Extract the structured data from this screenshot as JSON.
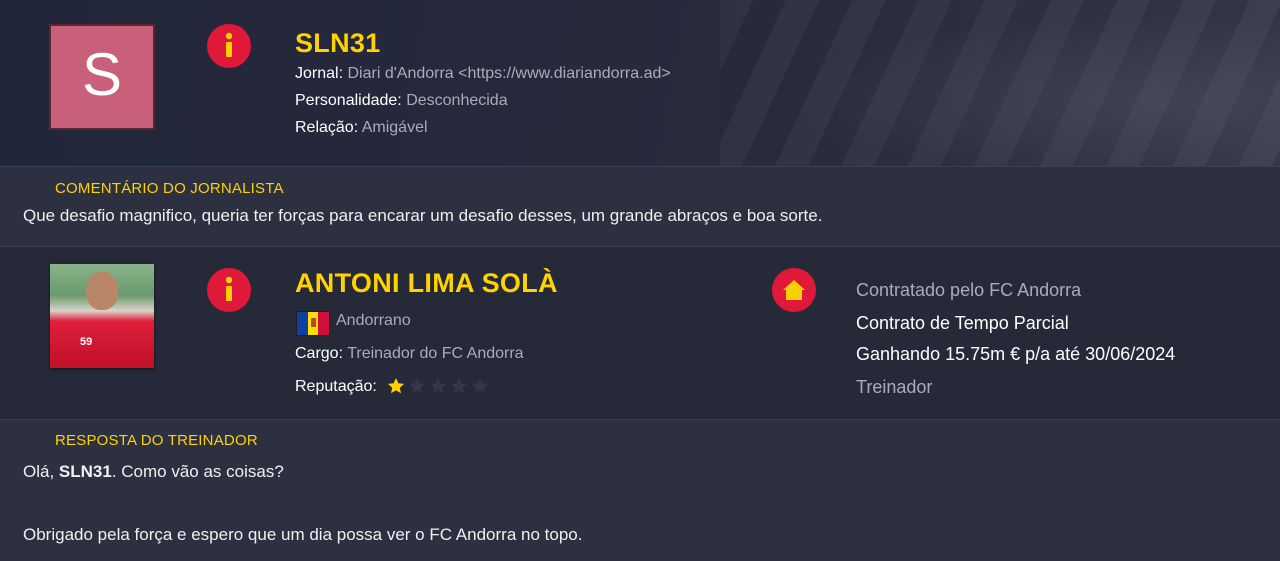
{
  "journalist": {
    "avatar_letter": "S",
    "name": "SLN31",
    "rows": [
      {
        "key": "Jornal:",
        "value": "Diari d'Andorra <https://www.diariandorra.ad>"
      },
      {
        "key": "Personalidade:",
        "value": "Desconhecida"
      },
      {
        "key": "Relação:",
        "value": "Amigável"
      }
    ]
  },
  "comment": {
    "label": "COMENTÁRIO DO JORNALISTA",
    "text": "Que desafio magnifico, queria ter forças para encarar um desafio desses, um grande abraços e boa sorte."
  },
  "coach": {
    "name": "ANTONI LIMA SOLÀ",
    "nationality": "Andorrano",
    "role_key": "Cargo:",
    "role_value": "Treinador do FC Andorra",
    "reputation_key": "Reputação:",
    "reputation_stars": 1,
    "reputation_max": 5,
    "shirt_text": "59",
    "contract": {
      "hired": "Contratado pelo FC Andorra",
      "type": "Contrato de Tempo Parcial",
      "salary": "Ganhando 15.75m € p/a até 30/06/2024",
      "position": "Treinador"
    }
  },
  "reply": {
    "label": "RESPOSTA DO TREINADOR",
    "greeting_pre": "Olá, ",
    "greeting_name": "SLN31",
    "greeting_post": ". Como vão as coisas?",
    "text": "Obrigado pela força e espero que um dia possa ver o FC Andorra no topo."
  },
  "colors": {
    "accent_yellow": "#ffd200",
    "icon_red": "#e0193a",
    "avatar_pink": "#c9607a"
  }
}
